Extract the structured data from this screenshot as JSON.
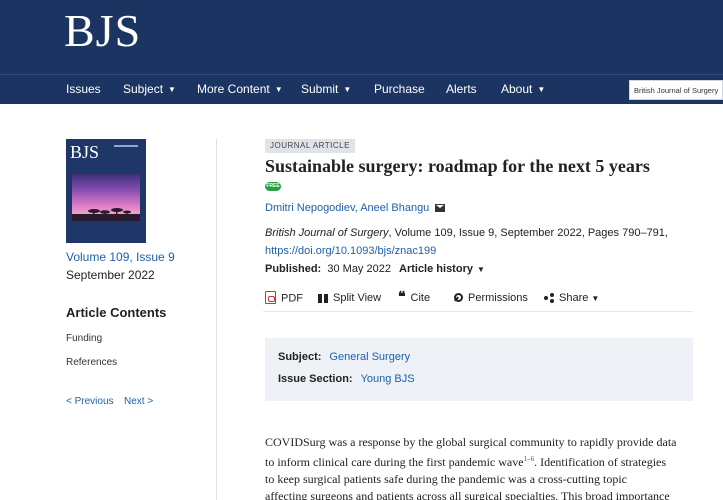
{
  "header": {
    "logo": "BJS",
    "nav": [
      {
        "label": "Issues",
        "dropdown": false
      },
      {
        "label": "Subject",
        "dropdown": true
      },
      {
        "label": "More Content",
        "dropdown": true
      },
      {
        "label": "Submit",
        "dropdown": true
      },
      {
        "label": "Purchase",
        "dropdown": false
      },
      {
        "label": "Alerts",
        "dropdown": false
      },
      {
        "label": "About",
        "dropdown": true
      }
    ],
    "search_scope": "British Journal of Surgery",
    "caret": "▼"
  },
  "sidebar": {
    "cover_title": "BJS",
    "volume_issue": "Volume 109, Issue 9",
    "issue_date": "September 2022",
    "contents_heading": "Article Contents",
    "contents_items": [
      "Funding",
      "References"
    ],
    "prev_label": "< Previous",
    "next_label": "Next >"
  },
  "article": {
    "type_label": "JOURNAL ARTICLE",
    "title": "Sustainable surgery: roadmap for the next 5 years",
    "free_label": "FREE",
    "authors": [
      "Dmitri Nepogodiev",
      "Aneel Bhangu"
    ],
    "author_separator": ",",
    "journal": "British Journal of Surgery",
    "citation_rest": ", Volume 109, Issue 9, September 2022, Pages 790–791,",
    "doi": "https://doi.org/10.1093/bjs/znac199",
    "published_label": "Published:",
    "published_date": "30 May 2022",
    "history_label": "Article history",
    "history_caret": "▼"
  },
  "toolbar": {
    "pdf": "PDF",
    "split_view": "Split View",
    "cite": "Cite",
    "cite_icon": "❝",
    "permissions": "Permissions",
    "share": "Share",
    "share_caret": "▼"
  },
  "subject_box": {
    "subject_label": "Subject:",
    "subject_value": "General Surgery",
    "issue_section_label": "Issue Section:",
    "issue_section_value": "Young BJS"
  },
  "body": {
    "line1": "COVIDSurg was a response by the global surgical community to rapidly provide data",
    "line2a": "to inform clinical care during the first pandemic wave",
    "line2_ref": "1–6",
    "line2b": ". Identification of strategies",
    "line3": "to keep surgical patients safe during the pandemic was a cross-cutting topic",
    "line4": "affecting surgeons and patients across all surgical specialties. This broad importance"
  },
  "icons": {
    "pdf": "pdf-icon",
    "split_view": "split-view-icon",
    "cite": "quote-icon",
    "permissions": "key-icon",
    "share": "share-icon",
    "email": "envelope-icon"
  },
  "colors": {
    "header_bg": "#1c3462",
    "link": "#1f5fae",
    "free_badge": "#27a043",
    "subject_bg": "#eef1f5"
  }
}
